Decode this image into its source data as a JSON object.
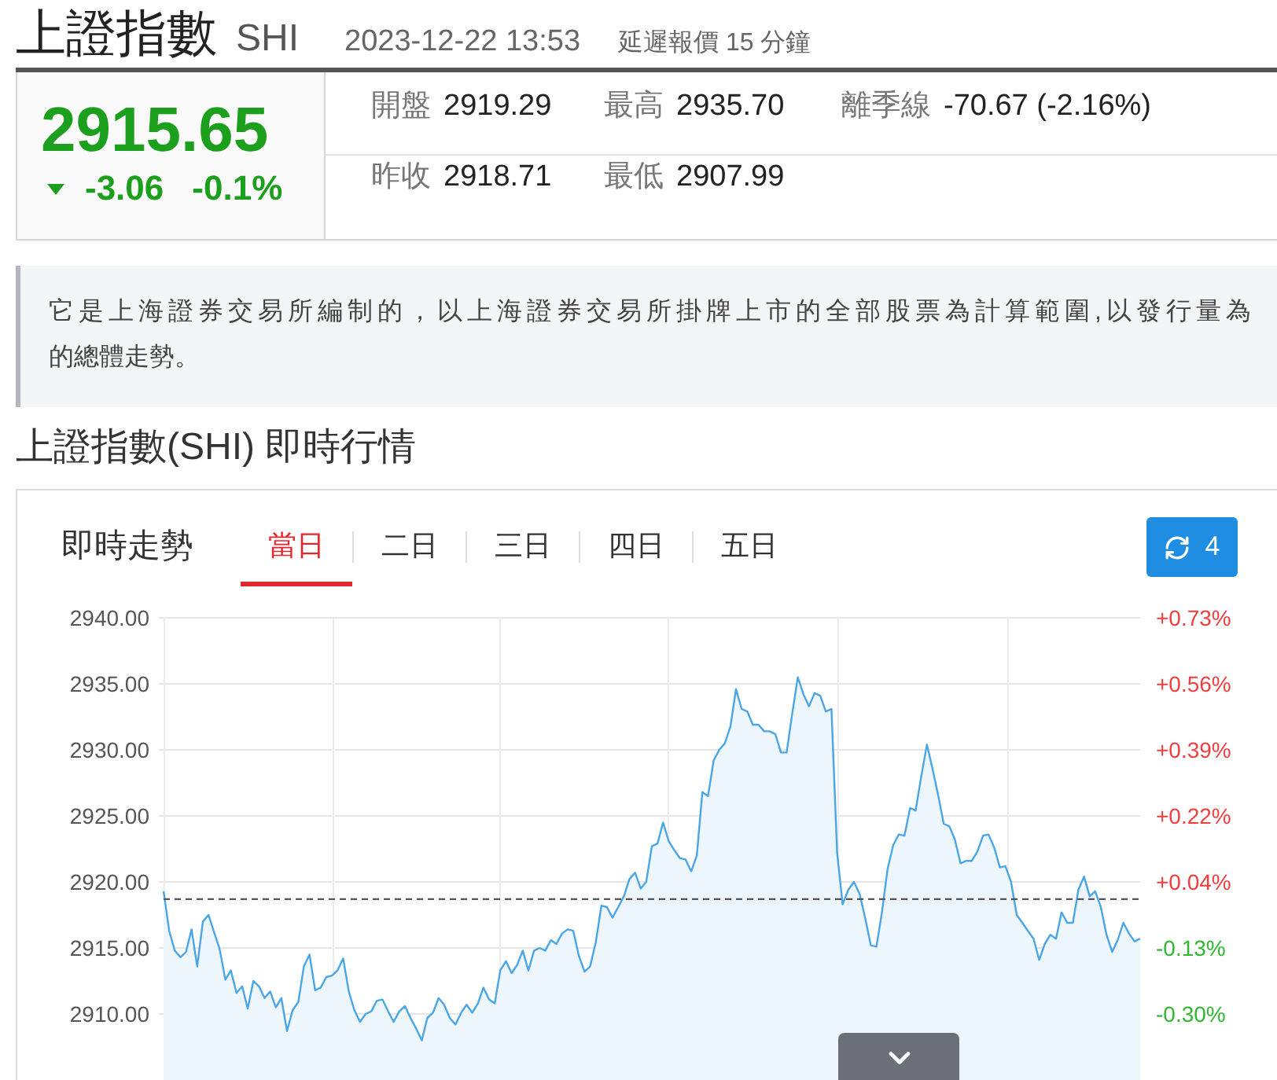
{
  "header": {
    "title": "上證指數",
    "symbol": "SHI",
    "datetime": "2023-12-22 13:53",
    "delay_note": "延遲報價 15 分鐘"
  },
  "quote": {
    "price": "2915.65",
    "falling": true,
    "change": "-3.06",
    "change_percent": "-0.1%",
    "rows": [
      {
        "fields": [
          {
            "label": "開盤",
            "value": "2919.29"
          },
          {
            "label": "最高",
            "value": "2935.70"
          },
          {
            "label": "離季線",
            "value": "-70.67 (-2.16%)"
          }
        ]
      },
      {
        "fields": [
          {
            "label": "昨收",
            "value": "2918.71"
          },
          {
            "label": "最低",
            "value": "2907.99"
          }
        ]
      }
    ]
  },
  "description_lines": [
    "它是上海證券交易所編制的，以上海證券交易所掛牌上市的全部股票為計算範圍,以發行量為",
    "的總體走勢。"
  ],
  "section_title": "上證指數(SHI) 即時行情",
  "chart_panel": {
    "title": "即時走勢",
    "tabs": [
      {
        "label": "當日",
        "selected": true
      },
      {
        "label": "二日",
        "selected": false
      },
      {
        "label": "三日",
        "selected": false
      },
      {
        "label": "四日",
        "selected": false
      },
      {
        "label": "五日",
        "selected": false
      }
    ],
    "refresh_button": {
      "label": "4"
    },
    "chart_data": {
      "type": "area",
      "grid": true,
      "ylim": [
        2905,
        2940
      ],
      "yticks": [
        {
          "value": 2940,
          "label": "2940.00"
        },
        {
          "value": 2935,
          "label": "2935.00"
        },
        {
          "value": 2930,
          "label": "2930.00"
        },
        {
          "value": 2925,
          "label": "2925.00"
        },
        {
          "value": 2920,
          "label": "2920.00"
        },
        {
          "value": 2915,
          "label": "2915.00"
        },
        {
          "value": 2910,
          "label": "2910.00"
        }
      ],
      "ref_lines": [
        {
          "axis": "y",
          "value": 2918.7
        }
      ],
      "values": [
        2919.3,
        2916.3,
        2914.8,
        2914.3,
        2914.7,
        2916.4,
        2913.6,
        2917.0,
        2917.5,
        2916.2,
        2914.9,
        2912.6,
        2913.3,
        2911.6,
        2912.1,
        2910.4,
        2912.5,
        2912.1,
        2911.2,
        2911.7,
        2910.5,
        2911.2,
        2908.7,
        2910.3,
        2910.9,
        2913.6,
        2914.5,
        2911.8,
        2912.0,
        2912.8,
        2912.9,
        2913.3,
        2914.2,
        2911.7,
        2910.3,
        2909.4,
        2910.0,
        2910.2,
        2911.0,
        2911.1,
        2910.2,
        2909.4,
        2910.2,
        2910.6,
        2909.7,
        2908.9,
        2908.0,
        2909.7,
        2910.1,
        2911.2,
        2910.7,
        2909.7,
        2909.2,
        2910.1,
        2910.7,
        2910.1,
        2910.8,
        2912.0,
        2911.1,
        2910.8,
        2913.3,
        2914.0,
        2913.1,
        2913.7,
        2914.8,
        2913.3,
        2914.8,
        2915.0,
        2914.8,
        2915.6,
        2915.3,
        2916.1,
        2916.4,
        2916.3,
        2914.4,
        2913.2,
        2913.6,
        2915.4,
        2918.2,
        2918.1,
        2917.3,
        2918.1,
        2918.9,
        2920.2,
        2920.7,
        2919.5,
        2920.0,
        2922.7,
        2922.9,
        2924.5,
        2923.1,
        2922.4,
        2921.8,
        2921.7,
        2920.8,
        2922.0,
        2926.8,
        2926.5,
        2929.2,
        2930.0,
        2930.5,
        2931.8,
        2934.6,
        2933.1,
        2932.9,
        2931.9,
        2931.9,
        2931.4,
        2931.4,
        2931.2,
        2929.8,
        2929.8,
        2932.7,
        2935.5,
        2934.2,
        2933.3,
        2934.3,
        2934.1,
        2932.9,
        2933.1,
        2922.2,
        2918.3,
        2919.4,
        2920.0,
        2919.1,
        2917.3,
        2915.2,
        2915.1,
        2917.7,
        2921.0,
        2922.8,
        2923.6,
        2923.5,
        2925.6,
        2925.4,
        2928.0,
        2930.4,
        2928.6,
        2926.6,
        2924.4,
        2924.2,
        2923.2,
        2921.4,
        2921.6,
        2921.6,
        2922.3,
        2923.5,
        2923.6,
        2922.6,
        2921.1,
        2921.2,
        2920.0,
        2917.5,
        2916.9,
        2916.3,
        2915.7,
        2914.1,
        2915.3,
        2916.0,
        2915.7,
        2917.7,
        2916.9,
        2916.9,
        2919.4,
        2920.4,
        2918.9,
        2919.3,
        2918.1,
        2916.0,
        2914.7,
        2915.6,
        2916.9,
        2916.1,
        2915.5,
        2915.7
      ]
    },
    "percent_axis": [
      {
        "label": "+0.73%",
        "color": "#f23d3d"
      },
      {
        "label": "+0.56%",
        "color": "#f23d3d"
      },
      {
        "label": "+0.39%",
        "color": "#f23d3d"
      },
      {
        "label": "+0.22%",
        "color": "#f23d3d"
      },
      {
        "label": "+0.04%",
        "color": "#f23d3d"
      },
      {
        "label": "-0.13%",
        "color": "#2eb82e"
      },
      {
        "label": "-0.30%",
        "color": "#2eb82e"
      }
    ]
  }
}
